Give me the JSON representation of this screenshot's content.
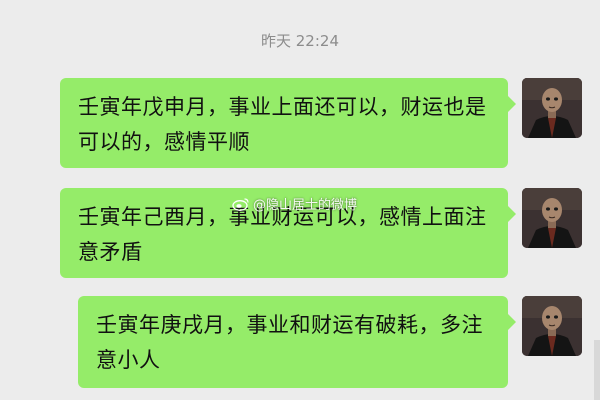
{
  "chat": {
    "timestamp": "昨天 22:24",
    "messages": [
      {
        "text": "壬寅年戊申月，事业上面还可以，财运也是可以的，感情平顺"
      },
      {
        "text": "壬寅年己酉月，事业财运可以，感情上面注意矛盾"
      },
      {
        "text": "壬寅年庚戌月，事业和财运有破耗，多注意小人"
      }
    ]
  },
  "watermark": {
    "text": "@隐山居士的微博"
  },
  "colors": {
    "background": "#ececec",
    "bubble": "#95ec69",
    "text": "#111111",
    "timestamp": "#8c8c8c"
  },
  "icons": {
    "avatar": "monk-avatar",
    "watermark_logo": "weibo-logo-icon"
  }
}
